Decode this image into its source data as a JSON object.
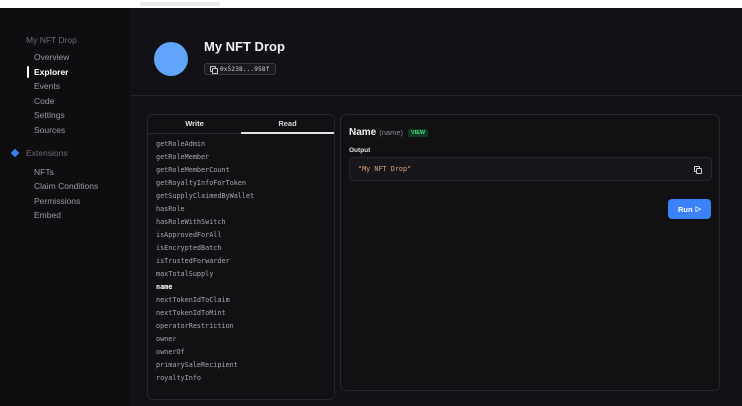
{
  "sidebar": {
    "heading": "My NFT Drop",
    "items": [
      {
        "label": "Overview",
        "active": false
      },
      {
        "label": "Explorer",
        "active": true
      },
      {
        "label": "Events",
        "active": false
      },
      {
        "label": "Code",
        "active": false
      },
      {
        "label": "Settings",
        "active": false
      },
      {
        "label": "Sources",
        "active": false
      }
    ],
    "extensions_label": "Extensions",
    "extensions": [
      "NFTs",
      "Claim Conditions",
      "Permissions",
      "Embed"
    ]
  },
  "header": {
    "title": "My NFT Drop",
    "address": "0x5238...958f",
    "avatar_color": "#60a5fa"
  },
  "tabs": {
    "write": "Write",
    "read": "Read",
    "active": "Read"
  },
  "functions": [
    "getRoleAdmin",
    "getRoleMember",
    "getRoleMemberCount",
    "getRoyaltyInfoForToken",
    "getSupplyClaimedByWallet",
    "hasRole",
    "hasRoleWithSwitch",
    "isApprovedForAll",
    "isEncryptedBatch",
    "isTrustedForwarder",
    "maxTotalSupply",
    "name",
    "nextTokenIdToClaim",
    "nextTokenIdToMint",
    "operatorRestriction",
    "owner",
    "ownerOf",
    "primarySaleRecipient",
    "royaltyInfo"
  ],
  "selected_function": "name",
  "result": {
    "name": "Name",
    "sub": "(name)",
    "badge": "VIEW",
    "output_label": "Output",
    "output_value": "\"My NFT Drop\"",
    "run_label": "Run",
    "run_icon": "▷"
  },
  "colors": {
    "accent": "#3b82f6",
    "view_badge": "#4ade80",
    "output_text": "#d9a27a"
  }
}
